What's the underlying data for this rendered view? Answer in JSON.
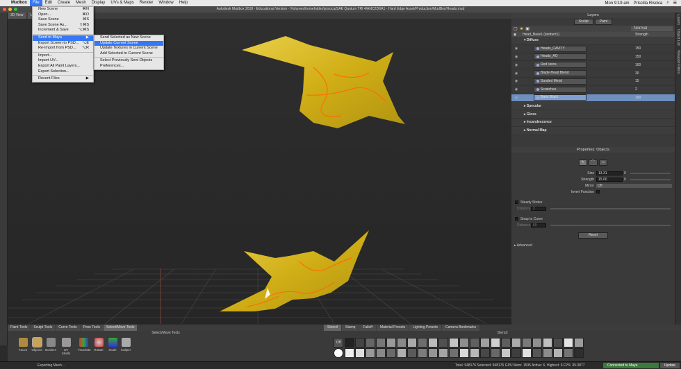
{
  "menubar": {
    "app": "Mudbox",
    "items": [
      "File",
      "Edit",
      "Create",
      "Mesh",
      "Display",
      "UVs & Maps",
      "Render",
      "Window",
      "Help"
    ],
    "clock": "Mon 9:19 am",
    "user": "Priscilla Riscica"
  },
  "window": {
    "title": "Autodesk Mudbox 2018 - Educational Version - /Volumes/homefolder/priscica/SAE Qantum TRI 4/ANC220/A1 - Hard Edge Asset/Production/MudBox/Heads.mud"
  },
  "viewport": {
    "tabs": [
      "3D View",
      "U"
    ]
  },
  "file_menu": {
    "items": [
      {
        "label": "New Scene",
        "shortcut": "⌘N"
      },
      {
        "label": "Open...",
        "shortcut": "⌘O"
      },
      {
        "label": "Save Scene",
        "shortcut": "⌘S"
      },
      {
        "label": "Save Scene As...",
        "shortcut": "⇧⌘S"
      },
      {
        "label": "Increment & Save",
        "shortcut": "⌥⌘S"
      },
      {
        "label": "Send to Maya",
        "shortcut": "▶"
      },
      {
        "label": "Export Screen to PSD...",
        "shortcut": "⌥E"
      },
      {
        "label": "Re-Import from PSD...",
        "shortcut": "⌥R"
      },
      {
        "label": "Import...",
        "shortcut": ""
      },
      {
        "label": "Import UV...",
        "shortcut": ""
      },
      {
        "label": "Export All Paint Layers...",
        "shortcut": ""
      },
      {
        "label": "Export Selection...",
        "shortcut": ""
      },
      {
        "label": "Recent Files",
        "shortcut": "▶"
      }
    ]
  },
  "submenu": {
    "items": [
      "Send Selected as New Scene",
      "Update Current Scene",
      "Update Textures in Current Scene",
      "Add Selected to Current Scene",
      "Select Previously Sent Objects",
      "Preferences..."
    ]
  },
  "layers": {
    "title": "Layers",
    "tabs": [
      "Sculpt",
      "Paint"
    ],
    "blend_mode": "Normal",
    "header_name": "Head_Base1 (lambert1)",
    "header_strength": "Strength",
    "group_diffuse": "Diffuse",
    "rows": [
      {
        "name": "Heads_CAVITY",
        "value": "150"
      },
      {
        "name": "Heads_AO",
        "value": "150"
      },
      {
        "name": "Red Veins",
        "value": "100"
      },
      {
        "name": "Blade-Head Blend",
        "value": "30"
      },
      {
        "name": "Sanded Metal",
        "value": "15"
      },
      {
        "name": "Scratches",
        "value": "2"
      },
      {
        "name": "Base Black",
        "value": "100"
      }
    ],
    "groups": [
      "Specular",
      "Gloss",
      "Incandescence",
      "Normal Map"
    ]
  },
  "properties": {
    "title": "Properties: Objects",
    "size_label": "Size",
    "size_value": "13.31",
    "size_min": "0",
    "strength_label": "Strength",
    "strength_value": "15.00",
    "strength_min": "0",
    "mirror_label": "Mirror",
    "mirror_value": "Off",
    "invert_label": "Invert Function",
    "steady_label": "Steady Stroke",
    "steady_distance_label": "Distance",
    "steady_distance_value": "2",
    "snap_label": "Snap to Curve",
    "snap_distance_label": "Distance",
    "snap_distance_value": "60",
    "reset": "Reset",
    "advanced": "Advanced"
  },
  "side_tabs": [
    "Layers",
    "Object List",
    "Viewport Filters"
  ],
  "tool_tabs": [
    "Paint Tools",
    "Sculpt Tools",
    "Curve Tools",
    "Pose Tools",
    "Select/Move Tools"
  ],
  "tools_header": "Select/Move Tools",
  "tools": [
    "Faces",
    "Objects",
    "Borders",
    "UV Shells",
    "Translate",
    "Rotate",
    "Scale",
    "Caliper"
  ],
  "stencil_tabs": [
    "Stencil",
    "Stamp",
    "Falloff",
    "Material Presets",
    "Lighting Presets",
    "Camera Bookmarks"
  ],
  "stencil_header": "Stencil",
  "stencil_off": "Off",
  "status": {
    "message": "Exporting Mesh...",
    "stats": "Total: 948176  Selected: 948176 GPU Mem: 1535  Active: 6, Highest: 6  FPS: 35.0877",
    "connected": "Connected to Maya",
    "update": "Update"
  },
  "colors": {
    "mesh": "#e6c21a",
    "veins": "#ff6a00",
    "highlight": "#3478f6",
    "selected_layer": "#6f8fbf"
  }
}
